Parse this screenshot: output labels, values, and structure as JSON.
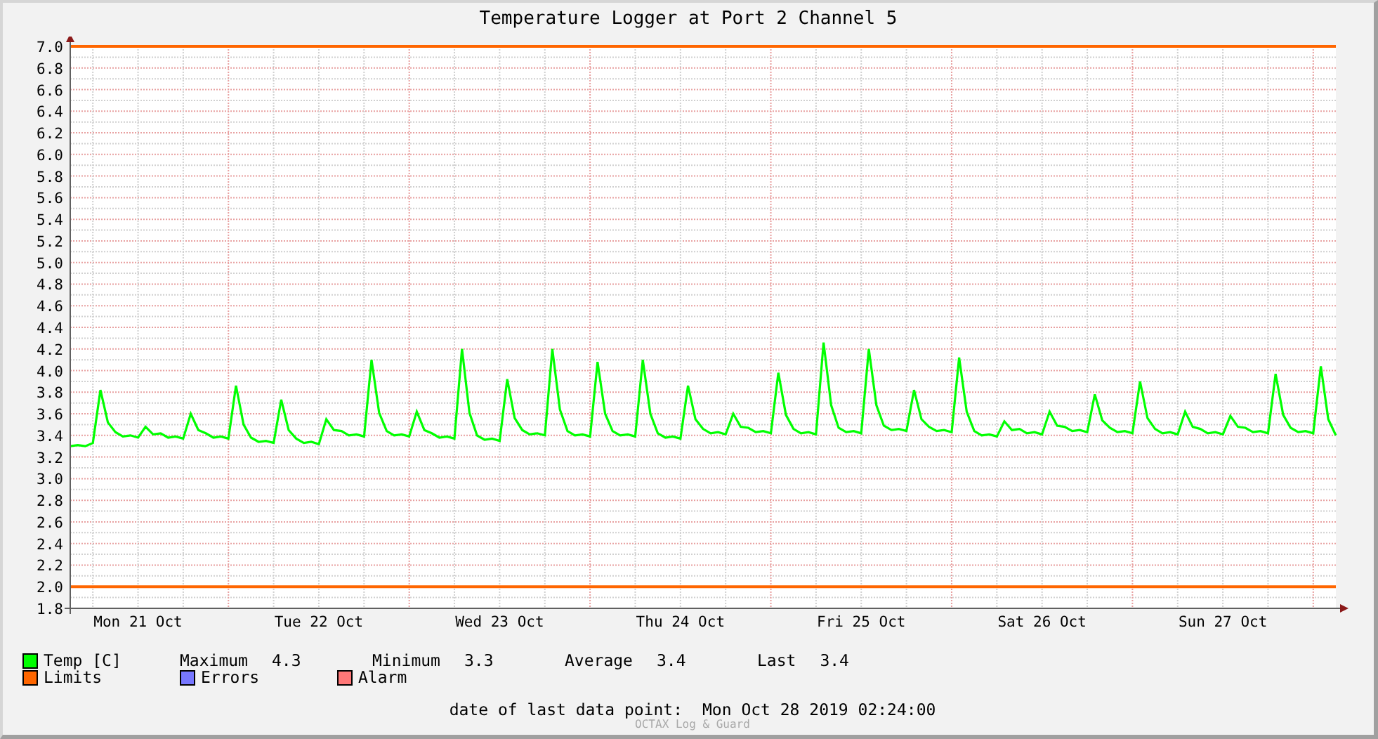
{
  "title": "Temperature Logger at Port 2 Channel 5",
  "chart_data": {
    "type": "line",
    "categories": [
      null,
      null,
      null,
      null,
      null,
      null,
      null,
      null,
      null,
      "Mon 21 Oct",
      null,
      null,
      null,
      null,
      null,
      null,
      null,
      null,
      null,
      null,
      null,
      null,
      null,
      null,
      null,
      null,
      null,
      null,
      null,
      null,
      null,
      null,
      null,
      "Tue 22 Oct",
      null,
      null,
      null,
      null,
      null,
      null,
      null,
      null,
      null,
      null,
      null,
      null,
      null,
      null,
      null,
      null,
      null,
      null,
      null,
      null,
      null,
      null,
      null,
      "Wed 23 Oct",
      null,
      null,
      null,
      null,
      null,
      null,
      null,
      null,
      null,
      null,
      null,
      null,
      null,
      null,
      null,
      null,
      null,
      null,
      null,
      null,
      null,
      null,
      null,
      "Thu 24 Oct",
      null,
      null,
      null,
      null,
      null,
      null,
      null,
      null,
      null,
      null,
      null,
      null,
      null,
      null,
      null,
      null,
      null,
      null,
      null,
      null,
      null,
      null,
      null,
      "Fri 25 Oct",
      null,
      null,
      null,
      null,
      null,
      null,
      null,
      null,
      null,
      null,
      null,
      null,
      null,
      null,
      null,
      null,
      null,
      null,
      null,
      null,
      null,
      null,
      null,
      "Sat 26 Oct",
      null,
      null,
      null,
      null,
      null,
      null,
      null,
      null,
      null,
      null,
      null,
      null,
      null,
      null,
      null,
      null,
      null,
      null,
      null,
      null,
      null,
      null,
      null,
      "Sun 27 Oct",
      null,
      null,
      null,
      null,
      null,
      null,
      null,
      null,
      null,
      null,
      null,
      null,
      null,
      null,
      null
    ],
    "series": [
      {
        "name": "Temp [C]",
        "color": "#00ff00",
        "values": [
          3.3,
          3.31,
          3.3,
          3.33,
          3.82,
          3.52,
          3.43,
          3.39,
          3.4,
          3.38,
          3.48,
          3.41,
          3.42,
          3.38,
          3.39,
          3.37,
          3.6,
          3.45,
          3.42,
          3.38,
          3.39,
          3.37,
          3.86,
          3.5,
          3.38,
          3.34,
          3.35,
          3.33,
          3.73,
          3.45,
          3.37,
          3.33,
          3.34,
          3.32,
          3.55,
          3.45,
          3.44,
          3.4,
          3.41,
          3.39,
          4.1,
          3.61,
          3.44,
          3.4,
          3.41,
          3.39,
          3.62,
          3.45,
          3.42,
          3.38,
          3.39,
          3.37,
          4.2,
          3.61,
          3.4,
          3.36,
          3.37,
          3.35,
          3.92,
          3.56,
          3.45,
          3.41,
          3.42,
          3.4,
          4.2,
          3.64,
          3.44,
          3.4,
          3.41,
          3.39,
          4.08,
          3.6,
          3.44,
          3.4,
          3.41,
          3.39,
          4.1,
          3.6,
          3.42,
          3.38,
          3.39,
          3.37,
          3.86,
          3.55,
          3.46,
          3.42,
          3.43,
          3.41,
          3.6,
          3.48,
          3.47,
          3.43,
          3.44,
          3.42,
          3.98,
          3.59,
          3.46,
          3.42,
          3.43,
          3.41,
          4.26,
          3.68,
          3.47,
          3.43,
          3.44,
          3.42,
          4.2,
          3.68,
          3.49,
          3.45,
          3.46,
          3.44,
          3.82,
          3.55,
          3.48,
          3.44,
          3.45,
          3.43,
          4.12,
          3.62,
          3.44,
          3.4,
          3.41,
          3.39,
          3.53,
          3.45,
          3.46,
          3.42,
          3.43,
          3.41,
          3.62,
          3.49,
          3.48,
          3.44,
          3.45,
          3.43,
          3.78,
          3.54,
          3.47,
          3.43,
          3.44,
          3.42,
          3.9,
          3.56,
          3.46,
          3.42,
          3.43,
          3.41,
          3.62,
          3.48,
          3.46,
          3.42,
          3.43,
          3.41,
          3.58,
          3.48,
          3.47,
          3.43,
          3.44,
          3.42,
          3.97,
          3.59,
          3.47,
          3.43,
          3.44,
          3.42,
          4.04,
          3.55,
          3.4
        ]
      }
    ],
    "ylim": [
      1.8,
      7.0
    ],
    "yticks": [
      {
        "value": 1.8,
        "label": "1.8"
      },
      {
        "value": 2.0,
        "label": "2.0"
      },
      {
        "value": 2.2,
        "label": "2.2"
      },
      {
        "value": 2.4,
        "label": "2.4"
      },
      {
        "value": 2.6,
        "label": "2.6"
      },
      {
        "value": 2.8,
        "label": "2.8"
      },
      {
        "value": 3.0,
        "label": "3.0"
      },
      {
        "value": 3.2,
        "label": "3.2"
      },
      {
        "value": 3.4,
        "label": "3.4"
      },
      {
        "value": 3.6,
        "label": "3.6"
      },
      {
        "value": 3.8,
        "label": "3.8"
      },
      {
        "value": 4.0,
        "label": "4.0"
      },
      {
        "value": 4.2,
        "label": "4.2"
      },
      {
        "value": 4.4,
        "label": "4.4"
      },
      {
        "value": 4.6,
        "label": "4.6"
      },
      {
        "value": 4.8,
        "label": "4.8"
      },
      {
        "value": 5.0,
        "label": "5.0"
      },
      {
        "value": 5.2,
        "label": "5.2"
      },
      {
        "value": 5.4,
        "label": "5.4"
      },
      {
        "value": 5.6,
        "label": "5.6"
      },
      {
        "value": 5.8,
        "label": "5.8"
      },
      {
        "value": 6.0,
        "label": "6.0"
      },
      {
        "value": 6.2,
        "label": "6.2"
      },
      {
        "value": 6.4,
        "label": "6.4"
      },
      {
        "value": 6.6,
        "label": "6.6"
      },
      {
        "value": 6.8,
        "label": "6.8"
      },
      {
        "value": 7.0,
        "label": "7.0"
      }
    ],
    "grid": true,
    "ref_lines": [
      {
        "axis": "y",
        "value": 7.0,
        "color": "#ff6600"
      },
      {
        "axis": "y",
        "value": 2.0,
        "color": "#ff6600"
      }
    ]
  },
  "legend": {
    "rows": [
      [
        {
          "kind": "chart_series"
        },
        {
          "kind": "stat",
          "label": "Maximum",
          "value": "4.3"
        },
        {
          "kind": "stat",
          "label": "Minimum",
          "value": "3.3"
        },
        {
          "kind": "stat",
          "label": "Average",
          "value": "3.4"
        },
        {
          "kind": "stat",
          "label": "Last",
          "value": "3.4"
        }
      ],
      [
        {
          "kind": "series",
          "label": "Limits",
          "color": "#ff6600"
        },
        {
          "kind": "series",
          "label": "Errors",
          "color": "#7777ff"
        },
        {
          "kind": "series",
          "label": "Alarm",
          "color": "#ff7777"
        }
      ]
    ]
  },
  "footer": {
    "label": "date of last data point:",
    "value": "Mon Oct 28 2019 02:24:00"
  },
  "credit": "OCTAX Log & Guard"
}
